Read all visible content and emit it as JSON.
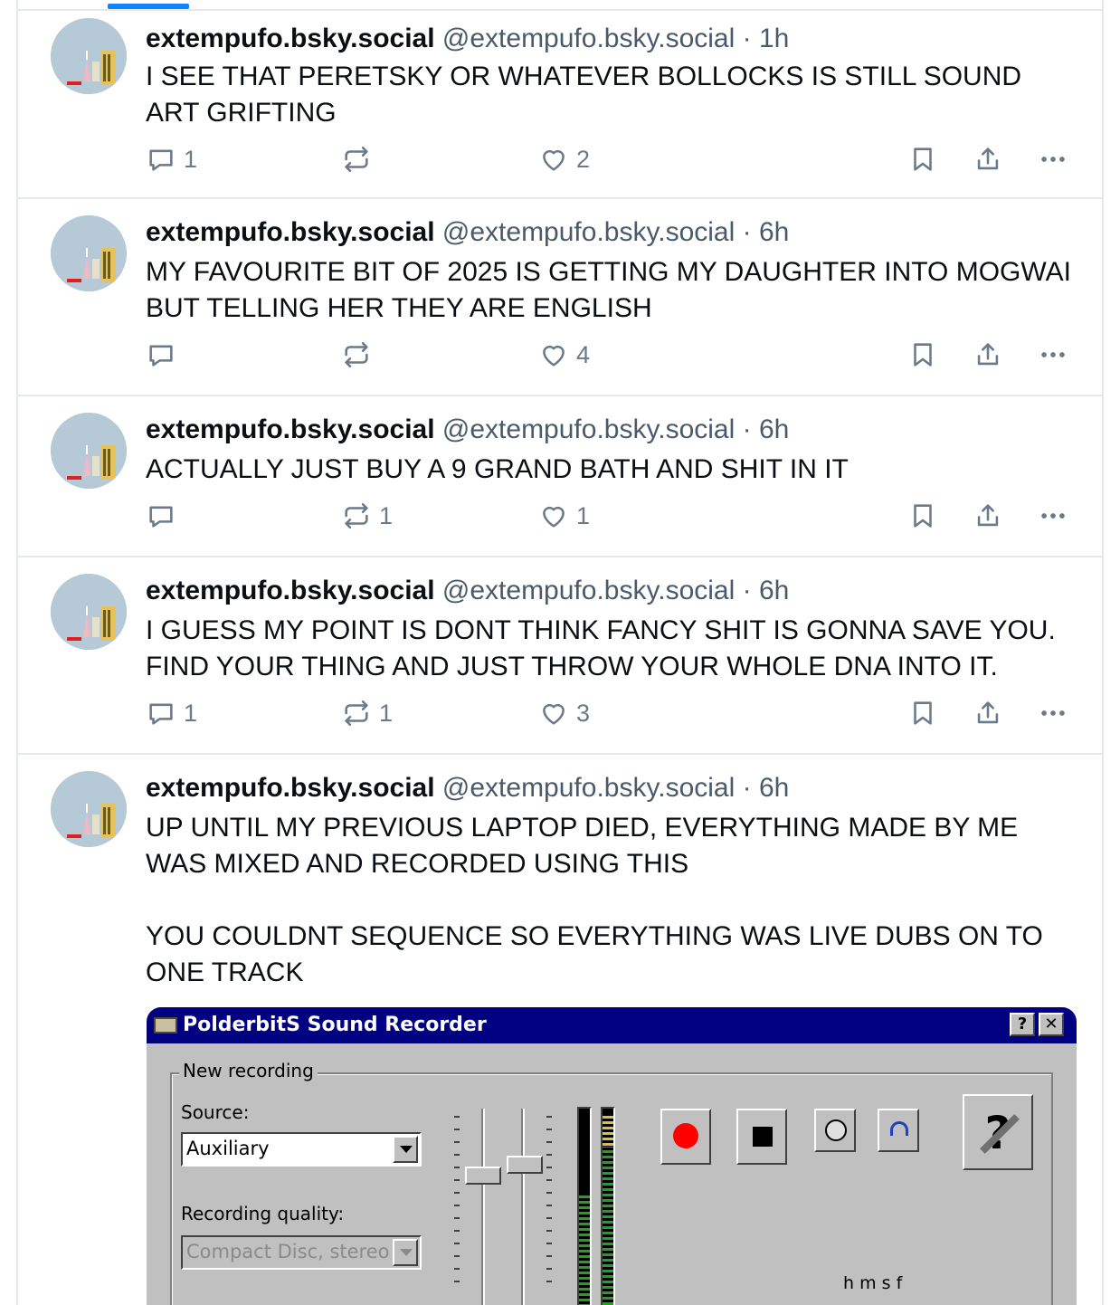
{
  "author": {
    "name": "extempufo.bsky.social",
    "handle": "@extempufo.bsky.social",
    "separator": "·"
  },
  "posts": [
    {
      "time": "1h",
      "text": "I SEE THAT PERETSKY OR WHATEVER BOLLOCKS IS STILL SOUND ART GRIFTING",
      "replies": "1",
      "reposts": "",
      "likes": "2"
    },
    {
      "time": "6h",
      "text": "MY FAVOURITE BIT OF 2025 IS GETTING MY DAUGHTER INTO MOGWAI BUT TELLING HER THEY ARE ENGLISH",
      "replies": "",
      "reposts": "",
      "likes": "4"
    },
    {
      "time": "6h",
      "text": "ACTUALLY JUST BUY A 9 GRAND BATH AND SHIT IN IT",
      "replies": "",
      "reposts": "1",
      "likes": "1"
    },
    {
      "time": "6h",
      "text": "I GUESS MY POINT IS DONT THINK FANCY SHIT IS GONNA SAVE YOU. FIND YOUR THING AND JUST THROW YOUR WHOLE DNA INTO IT.",
      "replies": "1",
      "reposts": "1",
      "likes": "3"
    },
    {
      "time": "6h",
      "text": "UP UNTIL MY PREVIOUS LAPTOP DIED, EVERYTHING MADE BY ME WAS MIXED AND RECORDED USING THIS\n\nYOU COULDNT SEQUENCE SO EVERYTHING WAS LIVE DUBS ON TO ONE TRACK"
    }
  ],
  "icons": {
    "reply": "speech-bubble-icon",
    "repost": "repost-arrows-icon",
    "like": "heart-icon",
    "bookmark": "bookmark-icon",
    "share": "share-icon",
    "more": "ellipsis-icon"
  },
  "embed": {
    "window_title": "PolderbitS Sound Recorder",
    "help_button": "?",
    "close_button": "✕",
    "group_label": "New recording",
    "source_label": "Source:",
    "source_value": "Auxiliary",
    "quality_label": "Recording quality:",
    "quality_value": "Compact Disc, stereo",
    "time_units": "h   m   s        f"
  },
  "colors": {
    "accent": "#1083fe",
    "text": "#0b0f14",
    "muted": "#4b5a6a",
    "icon": "#6b7a8a",
    "border": "#e4e8ec",
    "win_titlebar": "#000080",
    "win_face": "#c0c0c0",
    "record_red": "#ff0000"
  }
}
